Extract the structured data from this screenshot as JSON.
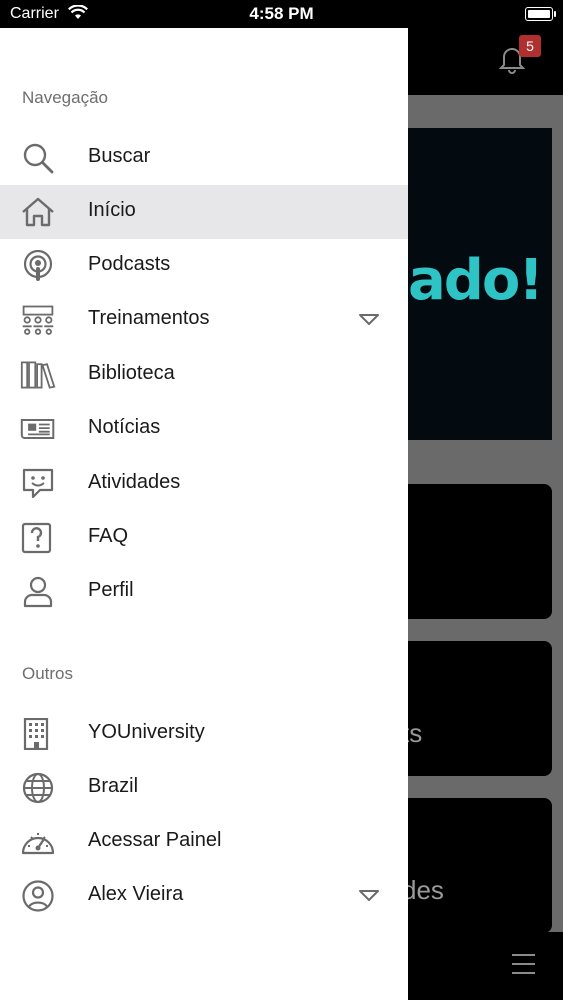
{
  "status_bar": {
    "carrier": "Carrier",
    "time": "4:58 PM"
  },
  "header": {
    "notification_count": "5"
  },
  "background": {
    "banner_text": "ado!",
    "cards": [
      {
        "text": ""
      },
      {
        "text": "ts"
      },
      {
        "text": "des"
      }
    ]
  },
  "drawer": {
    "nav_title": "Navegação",
    "nav_items": [
      {
        "label": "Buscar",
        "icon": "search-icon",
        "active": false
      },
      {
        "label": "Início",
        "icon": "home-icon",
        "active": true
      },
      {
        "label": "Podcasts",
        "icon": "podcast-icon",
        "active": false
      },
      {
        "label": "Treinamentos",
        "icon": "training-icon",
        "active": false,
        "expandable": true
      },
      {
        "label": "Biblioteca",
        "icon": "library-icon",
        "active": false
      },
      {
        "label": "Notícias",
        "icon": "newspaper-icon",
        "active": false
      },
      {
        "label": "Atividades",
        "icon": "chat-smile-icon",
        "active": false
      },
      {
        "label": "FAQ",
        "icon": "question-icon",
        "active": false
      },
      {
        "label": "Perfil",
        "icon": "user-icon",
        "active": false
      }
    ],
    "others_title": "Outros",
    "other_items": [
      {
        "label": "YOUniversity",
        "icon": "building-icon"
      },
      {
        "label": "Brazil",
        "icon": "globe-icon"
      },
      {
        "label": "Acessar Painel",
        "icon": "dashboard-icon"
      },
      {
        "label": "Alex Vieira",
        "icon": "user-circle-icon",
        "expandable": true
      }
    ]
  },
  "colors": {
    "accent_text": "#2ec4c6",
    "badge": "#b03030",
    "active_row": "#e7e6e8",
    "icon_gray": "#6b6b6b"
  }
}
